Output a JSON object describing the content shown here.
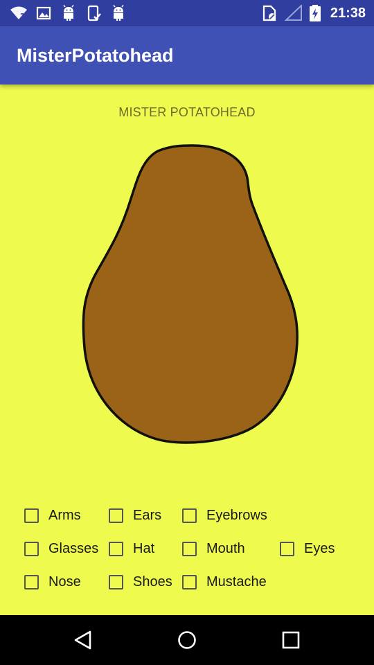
{
  "status_bar": {
    "time": "21:38",
    "icons": [
      "wifi-question-icon",
      "image-icon",
      "android-icon",
      "phone-check-icon",
      "android-icon",
      "sim-card-icon",
      "signal-icon",
      "battery-charging-icon"
    ]
  },
  "app_bar": {
    "title": "MisterPotatohead"
  },
  "main": {
    "heading": "MISTER POTATOHEAD",
    "potato": {
      "fill_color": "#9b6318",
      "outline_color": "#111111"
    },
    "options": [
      {
        "label": "Arms",
        "checked": false
      },
      {
        "label": "Ears",
        "checked": false
      },
      {
        "label": "Eyebrows",
        "checked": false
      },
      {
        "label": "Glasses",
        "checked": false
      },
      {
        "label": "Hat",
        "checked": false
      },
      {
        "label": "Mouth",
        "checked": false
      },
      {
        "label": "Eyes",
        "checked": false
      },
      {
        "label": "Nose",
        "checked": false
      },
      {
        "label": "Shoes",
        "checked": false
      },
      {
        "label": "Mustache",
        "checked": false
      }
    ]
  },
  "nav_bar": {
    "buttons": [
      "back-icon",
      "home-icon",
      "recents-icon"
    ]
  },
  "colors": {
    "status_bar": "#303f9f",
    "app_bar": "#3f51b5",
    "background": "#eefa4e",
    "nav_bar": "#000000"
  }
}
